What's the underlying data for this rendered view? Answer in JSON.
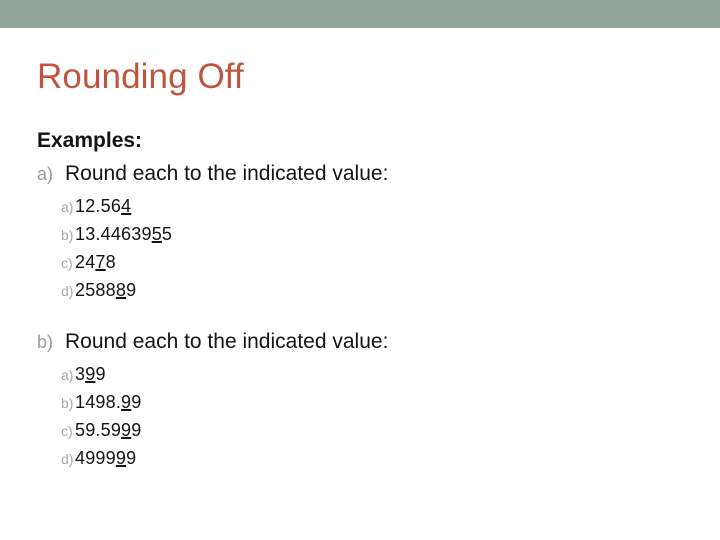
{
  "theme": {
    "accent_bar_color": "#93a59b",
    "title_color": "#c0543c",
    "body_text_color": "#141414",
    "marker_color": "#9b9b9b",
    "background_color": "#ffffff"
  },
  "slide": {
    "title": "Rounding Off",
    "examples_label": "Examples:",
    "sections": [
      {
        "marker": "a)",
        "prompt": "Round each to the indicated value:",
        "items": [
          {
            "marker": "a)",
            "pre": "12.56",
            "underlined": "4",
            "post": ""
          },
          {
            "marker": "b)",
            "pre": "13.44639",
            "underlined": "5",
            "post": "5"
          },
          {
            "marker": "c)",
            "pre": "24",
            "underlined": "7",
            "post": "8"
          },
          {
            "marker": "d)",
            "pre": "2588",
            "underlined": "8",
            "post": "9"
          }
        ]
      },
      {
        "marker": "b)",
        "prompt": "Round each to the indicated value:",
        "items": [
          {
            "marker": "a)",
            "pre": "3",
            "underlined": "9",
            "post": "9"
          },
          {
            "marker": "b)",
            "pre": "1498.",
            "underlined": "9",
            "post": "9"
          },
          {
            "marker": "c)",
            "pre": "59.59",
            "underlined": "9",
            "post": "9"
          },
          {
            "marker": "d)",
            "pre": "4999",
            "underlined": "9",
            "post": "9"
          }
        ]
      }
    ]
  }
}
